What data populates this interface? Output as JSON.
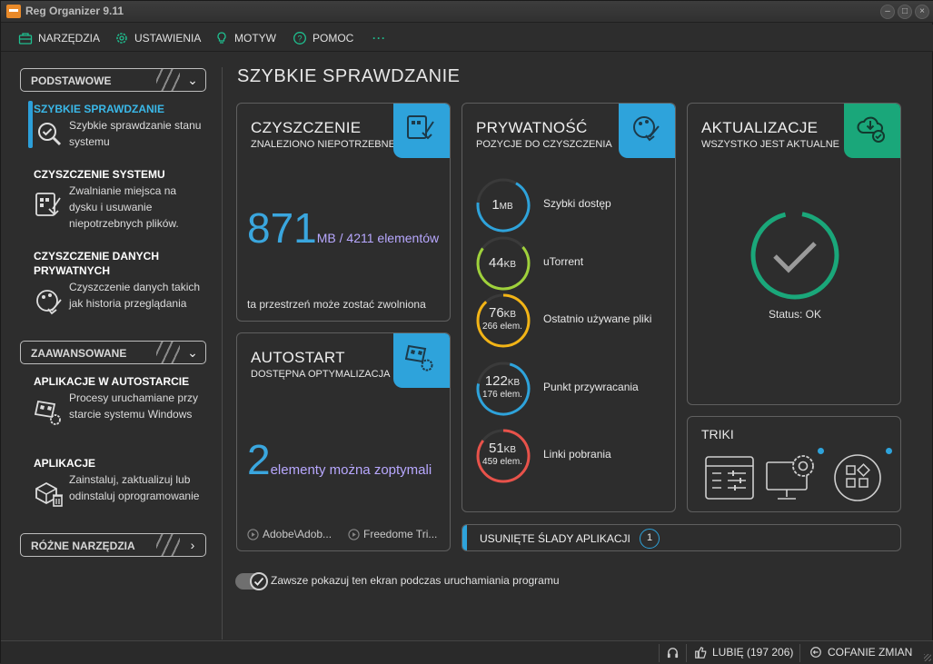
{
  "window": {
    "title": "Reg Organizer 9.11"
  },
  "menu": [
    {
      "label": "NARZĘDZIA",
      "icon": "toolbox-icon"
    },
    {
      "label": "USTAWIENIA",
      "icon": "gear-icon"
    },
    {
      "label": "MOTYW",
      "icon": "lightbulb-icon"
    },
    {
      "label": "POMOC",
      "icon": "help-icon"
    },
    {
      "label": "···",
      "icon": "more-icon"
    }
  ],
  "sidebar": {
    "section_basic": "PODSTAWOWE",
    "section_advanced": "ZAAWANSOWANE",
    "section_misc": "RÓŻNE NARZĘDZIA",
    "items": [
      {
        "title": "SZYBKIE SPRAWDZANIE",
        "desc": "Szybkie sprawdzanie stanu systemu",
        "icon": "magnifier-check-icon"
      },
      {
        "title": "CZYSZCZENIE SYSTEMU",
        "desc": "Zwalnianie miejsca na dysku i usuwanie niepotrzebnych plików.",
        "icon": "disk-broom-icon"
      },
      {
        "title": "CZYSZCZENIE DANYCH PRYWATNYCH",
        "desc": "Czyszczenie danych takich jak historia przeglądania",
        "icon": "privacy-broom-icon"
      },
      {
        "title": "APLIKACJE W AUTOSTARCIE",
        "desc": "Procesy uruchamiane przy starcie systemu Windows",
        "icon": "startup-flag-icon"
      },
      {
        "title": "APLIKACJE",
        "desc": "Zainstaluj, zaktualizuj lub odinstaluj oprogramowanie",
        "icon": "box-trash-icon"
      }
    ]
  },
  "main": {
    "title": "SZYBKIE SPRAWDZANIE",
    "cleanup": {
      "title": "CZYSZCZENIE",
      "subtitle": "ZNALEZIONO NIEPOTRZEBNE PLIKI",
      "value": "871",
      "unit": "MB / 4211 elementów",
      "note": "ta przestrzeń może zostać zwolniona"
    },
    "autostart": {
      "title": "AUTOSTART",
      "subtitle": "DOSTĘPNA OPTYMALIZACJA",
      "value": "2",
      "unit": "elementy można zoptymali",
      "apps": [
        "Adobe\\Adob...",
        "Freedome Tri..."
      ]
    },
    "privacy": {
      "title": "PRYWATNOŚĆ",
      "subtitle": "POZYCJE DO CZYSZCZENIA",
      "items": [
        {
          "value": "1",
          "unit": "MB",
          "extra": "",
          "name": "Szybki dostęp",
          "color": "#2ea3db"
        },
        {
          "value": "44",
          "unit": "KB",
          "extra": "",
          "name": "uTorrent",
          "color": "#9fd13b"
        },
        {
          "value": "76",
          "unit": "KB",
          "extra": "266 elem.",
          "name": "Ostatnio używane pliki",
          "color": "#f2b416"
        },
        {
          "value": "122",
          "unit": "KB",
          "extra": "176 elem.",
          "name": "Punkt przywracania",
          "color": "#2ea3db"
        },
        {
          "value": "51",
          "unit": "KB",
          "extra": "459 elem.",
          "name": "Linki pobrania",
          "color": "#e8524a"
        }
      ]
    },
    "updates": {
      "title": "AKTUALIZACJE",
      "subtitle": "WSZYSTKO JEST AKTUALNE",
      "status": "Status: OK"
    },
    "tricks": {
      "title": "TRIKI"
    },
    "traces": {
      "label": "USUNIĘTE ŚLADY APLIKACJI",
      "count": "1"
    },
    "toggle_label": "Zawsze pokazuj ten ekran podczas uruchamiania programu"
  },
  "statusbar": {
    "like": "LUBIĘ (197 206)",
    "undo": "COFANIE ZMIAN"
  },
  "colors": {
    "accent": "#2ea3db",
    "green": "#1aa77a"
  }
}
